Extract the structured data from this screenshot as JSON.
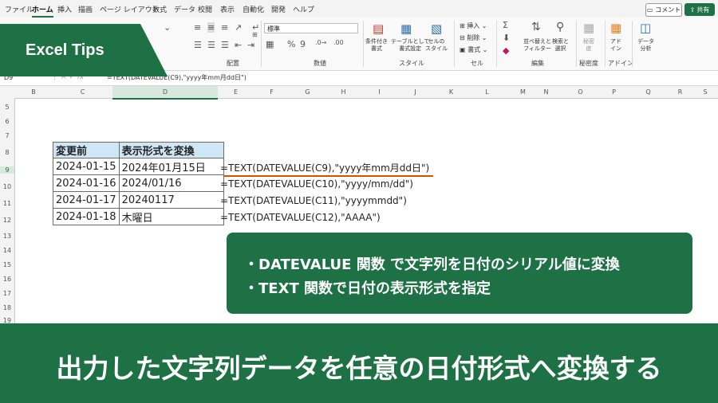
{
  "menu": {
    "tabs": [
      "ファイル",
      "ホーム",
      "挿入",
      "描画",
      "ページ レイアウト",
      "数式",
      "データ",
      "校閲",
      "表示",
      "自動化",
      "開発",
      "ヘルプ"
    ],
    "comment_label": "コメント",
    "share_label": "共有"
  },
  "ribbon": {
    "number_format": "標準",
    "groups": [
      "配置",
      "数値",
      "スタイル",
      "セル",
      "編集",
      "秘密度",
      "アドイン"
    ],
    "style_buttons": [
      "条件付き\n書式",
      "テーブルとして\n書式設定",
      "セルの\nスタイル"
    ],
    "cell_buttons": [
      "挿入",
      "削除",
      "書式"
    ],
    "edit_buttons": [
      "並べ替えと\nフィルター",
      "検索と\n選択"
    ],
    "sensitivity": "秘密\n度",
    "addin": "アド\nイン",
    "analyze": "データ\n分析"
  },
  "formula_bar": {
    "name_box": "D9",
    "formula": "=TEXT(DATEVALUE(C9),\"yyyy年mm月dd日\")"
  },
  "grid": {
    "columns": [
      "B",
      "C",
      "D",
      "E",
      "F",
      "G",
      "H",
      "I",
      "J",
      "K",
      "L",
      "M",
      "N",
      "O",
      "P",
      "Q",
      "R",
      "S"
    ],
    "rows": [
      "5",
      "6",
      "7",
      "8",
      "9",
      "10",
      "11",
      "12",
      "13",
      "14",
      "15",
      "16",
      "17",
      "18",
      "19"
    ]
  },
  "table": {
    "headers": [
      "変更前",
      "表示形式を変換"
    ],
    "rows": [
      [
        "2024-01-15",
        "2024年01月15日"
      ],
      [
        "2024-01-16",
        "2024/01/16"
      ],
      [
        "2024-01-17",
        "20240117"
      ],
      [
        "2024-01-18",
        "木曜日"
      ]
    ]
  },
  "formulas": [
    "=TEXT(DATEVALUE(C9),\"yyyy年mm月dd日\")",
    "=TEXT(DATEVALUE(C10),\"yyyy/mm/dd\")",
    "=TEXT(DATEVALUE(C11),\"yyyymmdd\")",
    "=TEXT(DATEVALUE(C12),\"AAAA\")"
  ],
  "tips": [
    "・DATEVALUE 関数 で文字列を日付のシリアル値に変換",
    "・TEXT 関数で日付の表示形式を指定"
  ],
  "badge": "Excel Tips",
  "banner": "出力した文字列データを任意の日付形式へ変換する",
  "colors": {
    "brand_green": "#1e7145",
    "header_fill": "#cfe6f5",
    "accent_underline": "#d35400"
  }
}
